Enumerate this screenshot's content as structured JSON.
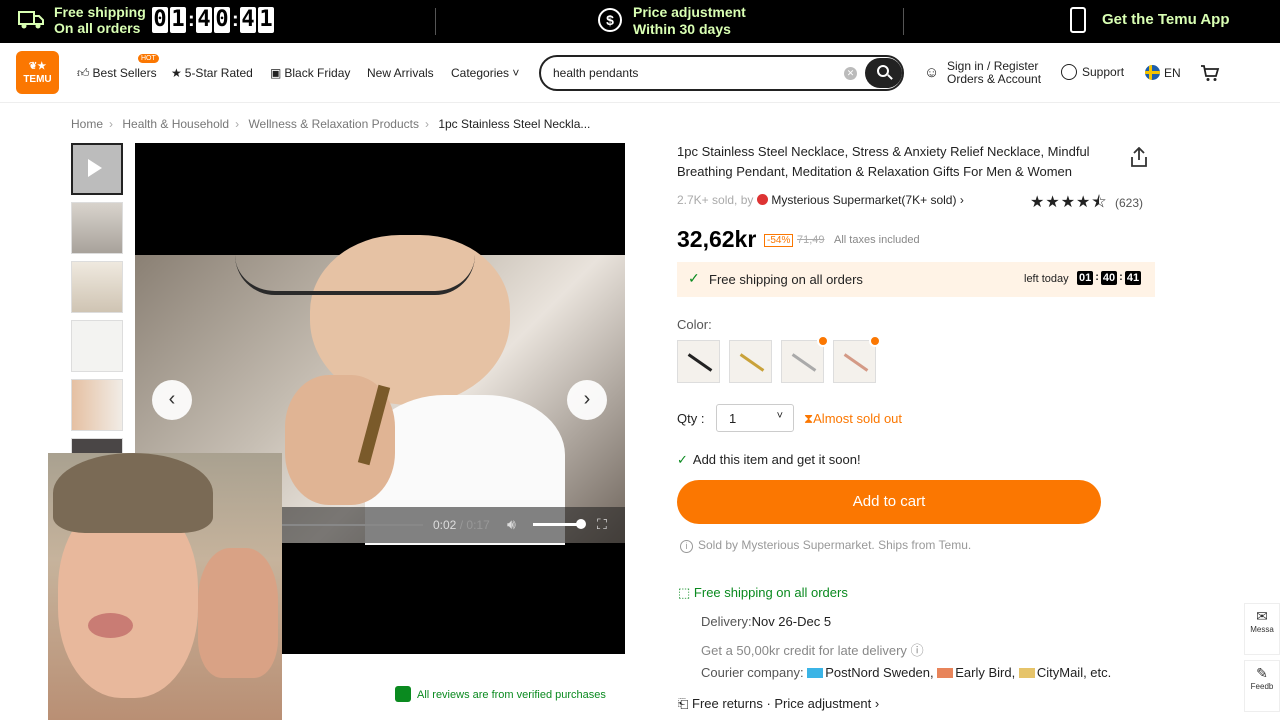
{
  "topbar": {
    "free_shipping_l1": "Free shipping",
    "free_shipping_l2": "On all orders",
    "timer": [
      "0",
      "1",
      "4",
      "0",
      "4",
      "1"
    ],
    "price_adj_l1": "Price adjustment",
    "price_adj_l2": "Within 30 days",
    "get_app": "Get the Temu App"
  },
  "nav": {
    "logo": "TEMU",
    "best_sellers": "Best Sellers",
    "hot_badge": "HOT",
    "five_star": "5-Star Rated",
    "black_friday": "Black Friday",
    "new_arrivals": "New Arrivals",
    "categories": "Categories",
    "search_value": "health pendants",
    "signin_l1": "Sign in / Register",
    "signin_l2": "Orders & Account",
    "support": "Support",
    "lang": "EN"
  },
  "breadcrumb": [
    "Home",
    "Health & Household",
    "Wellness & Relaxation Products",
    "1pc Stainless Steel Neckla..."
  ],
  "video": {
    "time_current": "0:02",
    "time_sep": "/",
    "time_total": "0:17"
  },
  "reviews_badge": "All reviews are from verified purchases",
  "product": {
    "title": "1pc Stainless Steel Necklace, Stress & Anxiety Relief Necklace, Mindful Breathing Pendant, Meditation & Relaxation Gifts For Men & Women",
    "sold": "2.7K+ sold, by",
    "store": "Mysterious Supermarket(7K+ sold)",
    "rating": 4.5,
    "review_count": "(623)",
    "price": "32,62kr",
    "discount": "-54%",
    "original_price": "71,49",
    "taxes": "All taxes included",
    "ship_bar_text": "Free shipping on all orders",
    "left_today": "left today",
    "countdown": [
      "01",
      "40",
      "41"
    ],
    "color_label": "Color:",
    "qty_label": "Qty :",
    "qty_value": "1",
    "almost_sold_out": "Almost sold out",
    "add_soon": "Add this item and get it soon!",
    "add_to_cart": "Add to cart",
    "sold_by": "Sold by Mysterious Supermarket. Ships from Temu.",
    "free_shipping": "Free shipping on all orders",
    "delivery_label": "Delivery:",
    "delivery_value": "Nov 26-Dec 5",
    "credit": "Get a 50,00kr credit for late delivery",
    "courier_label": "Courier company:",
    "courier_1": "PostNord Sweden,",
    "courier_2": "Early Bird,",
    "courier_3": "CityMail, etc.",
    "returns": "Free returns · Price adjustment"
  },
  "side": {
    "message": "Messa",
    "feedback": "Feedb"
  },
  "colors": {
    "accent": "#fb7701",
    "green": "#0a8a1f"
  }
}
